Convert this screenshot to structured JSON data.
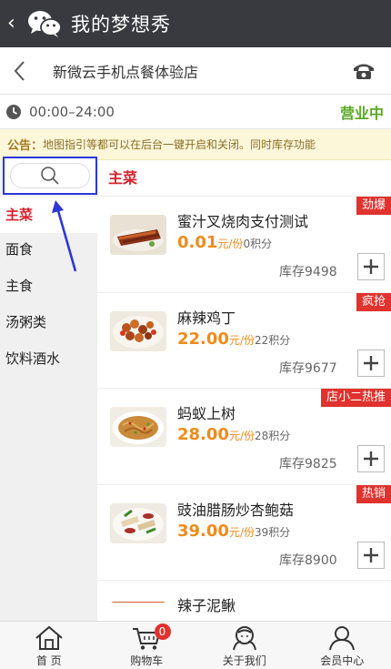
{
  "wechat": {
    "back_glyph": "‹",
    "title": "我的梦想秀"
  },
  "store": {
    "name": "新微云手机点餐体验店",
    "back_icon": "chevron-left-icon",
    "phone_icon": "phone-icon"
  },
  "hours": {
    "text": "00:00–24:00",
    "status": "营业中",
    "status_color": "#5aa826"
  },
  "notice": {
    "label": "公告：",
    "text": "地图指引等都可以在后台一键开启和关闭。同时库存功能"
  },
  "sidebar": {
    "categories": [
      {
        "label": "主菜",
        "active": true
      },
      {
        "label": "面食",
        "active": false
      },
      {
        "label": "主食",
        "active": false
      },
      {
        "label": "汤粥类",
        "active": false
      },
      {
        "label": "饮料酒水",
        "active": false
      }
    ]
  },
  "main": {
    "section_title": "主菜",
    "dishes": [
      {
        "name": "蜜汁叉烧肉支付测试",
        "price": "0.01",
        "unit": "元/份",
        "points": "0积分",
        "stock": "库存9498",
        "badge": "劲爆"
      },
      {
        "name": "麻辣鸡丁",
        "price": "22.00",
        "unit": "元/份",
        "points": "22积分",
        "stock": "库存9677",
        "badge": "疯抢"
      },
      {
        "name": "蚂蚁上树",
        "price": "28.00",
        "unit": "元/份",
        "points": "28积分",
        "stock": "库存9825",
        "badge": "店小二热推"
      },
      {
        "name": "豉油腊肠炒杏鲍菇",
        "price": "39.00",
        "unit": "元/份",
        "points": "39积分",
        "stock": "库存8900",
        "badge": "热销"
      },
      {
        "name": "辣子泥鳅"
      }
    ]
  },
  "nav": {
    "items": [
      {
        "label": "首 页",
        "icon": "home-icon"
      },
      {
        "label": "购物车",
        "icon": "cart-icon",
        "count": "0"
      },
      {
        "label": "关于我们",
        "icon": "about-icon"
      },
      {
        "label": "会员中心",
        "icon": "member-icon"
      }
    ]
  },
  "colors": {
    "accent": "#d9202b",
    "price": "#ef8b1c",
    "badge": "#e0322e",
    "annotation": "#2d37d8"
  }
}
